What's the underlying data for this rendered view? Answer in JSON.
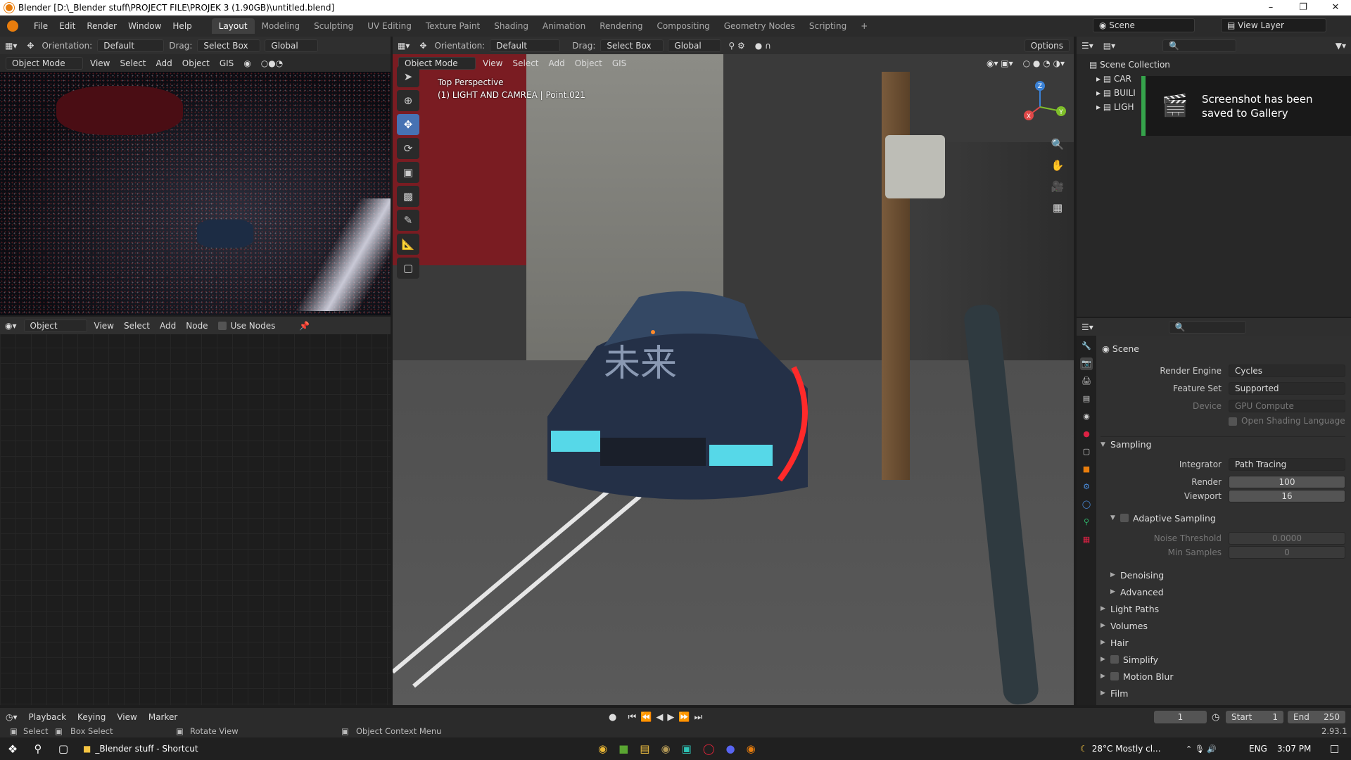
{
  "window": {
    "title": "Blender [D:\\_Blender stuff\\PROJECT FILE\\PROJEK 3 (1.90GB)\\untitled.blend]"
  },
  "menu": [
    "File",
    "Edit",
    "Render",
    "Window",
    "Help"
  ],
  "workspaces": [
    "Layout",
    "Modeling",
    "Sculpting",
    "UV Editing",
    "Texture Paint",
    "Shading",
    "Animation",
    "Rendering",
    "Compositing",
    "Geometry Nodes",
    "Scripting",
    "+"
  ],
  "scene_field": "Scene",
  "view_layer_field": "View Layer",
  "left_viewport": {
    "orientation_label": "Orientation:",
    "orientation_value": "Default",
    "drag_label": "Drag:",
    "drag_value": "Select Box",
    "transform_value": "Global",
    "mode": "Object Mode",
    "menus": [
      "View",
      "Select",
      "Add",
      "Object",
      "GIS"
    ]
  },
  "node_editor": {
    "type": "Object",
    "menus": [
      "View",
      "Select",
      "Add",
      "Node"
    ],
    "use_nodes_label": "Use Nodes"
  },
  "main_viewport": {
    "orientation_label": "Orientation:",
    "orientation_value": "Default",
    "drag_label": "Drag:",
    "drag_value": "Select Box",
    "transform_value": "Global",
    "options_label": "Options",
    "mode": "Object Mode",
    "menus": [
      "View",
      "Select",
      "Add",
      "Object",
      "GIS"
    ],
    "info_line1": "Top Perspective",
    "info_line2": "(1) LIGHT AND CAMREA | Point.021",
    "car_text": "未来",
    "gizmo_colors": {
      "x": "#e04848",
      "y": "#7fbf2a",
      "z": "#3b82d6"
    }
  },
  "outliner": {
    "root": "Scene Collection",
    "items": [
      "CAR",
      "BUILI",
      "LIGH"
    ]
  },
  "notification": {
    "text": "Screenshot has been saved to Gallery"
  },
  "properties": {
    "header": "Scene",
    "render_engine_label": "Render Engine",
    "render_engine_value": "Cycles",
    "feature_set_label": "Feature Set",
    "feature_set_value": "Supported",
    "device_label": "Device",
    "device_value": "GPU Compute",
    "osl_label": "Open Shading Language",
    "sampling": "Sampling",
    "integrator_label": "Integrator",
    "integrator_value": "Path Tracing",
    "render_label": "Render",
    "render_value": "100",
    "viewport_label": "Viewport",
    "viewport_value": "16",
    "adaptive_label": "Adaptive Sampling",
    "noise_label": "Noise Threshold",
    "noise_value": "0.0000",
    "min_samples_label": "Min Samples",
    "min_samples_value": "0",
    "denoising": "Denoising",
    "advanced": "Advanced",
    "light_paths": "Light Paths",
    "volumes": "Volumes",
    "hair": "Hair",
    "simplify": "Simplify",
    "motion_blur": "Motion Blur",
    "film": "Film"
  },
  "timeline": {
    "playback": "Playback",
    "keying": "Keying",
    "view": "View",
    "marker": "Marker",
    "current_frame": "1",
    "start_label": "Start",
    "start_value": "1",
    "end_label": "End",
    "end_value": "250"
  },
  "statusbar": {
    "select": "Select",
    "box_select": "Box Select",
    "rotate_view": "Rotate View",
    "context_menu": "Object Context Menu",
    "version": "2.93.1"
  },
  "taskbar": {
    "app_label": "_Blender stuff - Shortcut",
    "weather": "28°C  Mostly cl...",
    "lang": "ENG",
    "time": "3:07 PM"
  }
}
